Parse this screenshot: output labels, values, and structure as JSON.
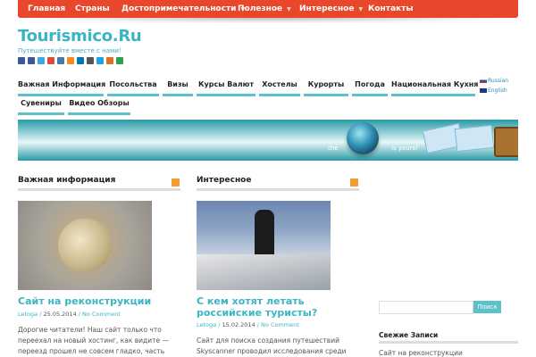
{
  "top_nav": {
    "items": [
      {
        "label": "Главная"
      },
      {
        "label": "Страны"
      },
      {
        "label": "Достопримечательности",
        "has_dropdown": true
      },
      {
        "label": "Полезное",
        "has_dropdown": true
      },
      {
        "label": "Интересное",
        "has_dropdown": true
      },
      {
        "label": "Контакты"
      }
    ]
  },
  "site": {
    "title": "Tourismico.Ru",
    "tagline": "Путешествуйте вместе с нами!"
  },
  "main_nav": {
    "items": [
      {
        "label": "Важная Информация"
      },
      {
        "label": "Посольства"
      },
      {
        "label": "Визы"
      },
      {
        "label": "Курсы Валют"
      },
      {
        "label": "Хостелы"
      },
      {
        "label": "Курорты"
      },
      {
        "label": "Погода"
      },
      {
        "label": "Национальная Кухня"
      },
      {
        "label": "Сувениры"
      },
      {
        "label": "Видео Обзоры"
      }
    ]
  },
  "languages": [
    "Russian",
    "English"
  ],
  "banner": {
    "word_left": "the",
    "word_right": "is yours!"
  },
  "sections": [
    {
      "heading": "Важная информация",
      "post": {
        "title": "Сайт на реконструкции",
        "author": "Letoga",
        "date": "25.05.2014",
        "comments": "No Comment",
        "excerpt": "Дорогие читатели! Наш сайт только что переехал на новый хостинг, как видите — переезд прошел не совсем гладко, часть"
      }
    },
    {
      "heading": "Интересное",
      "post": {
        "title": "С кем хотят летать российские туристы?",
        "author": "Letoga",
        "date": "15.02.2014",
        "comments": "No Comment",
        "excerpt": "Сайт для поиска создания путешествий Skyscanner проводил исследования среди"
      }
    }
  ],
  "sidebar": {
    "search_button": "Поиск",
    "recent_heading": "Свежие Записи",
    "recent_items": [
      "Сайт на реконструкции"
    ]
  },
  "colors": {
    "accent": "#3bb5c3",
    "topbar": "#e8472b",
    "nav_underline": "#5cc1c8"
  }
}
